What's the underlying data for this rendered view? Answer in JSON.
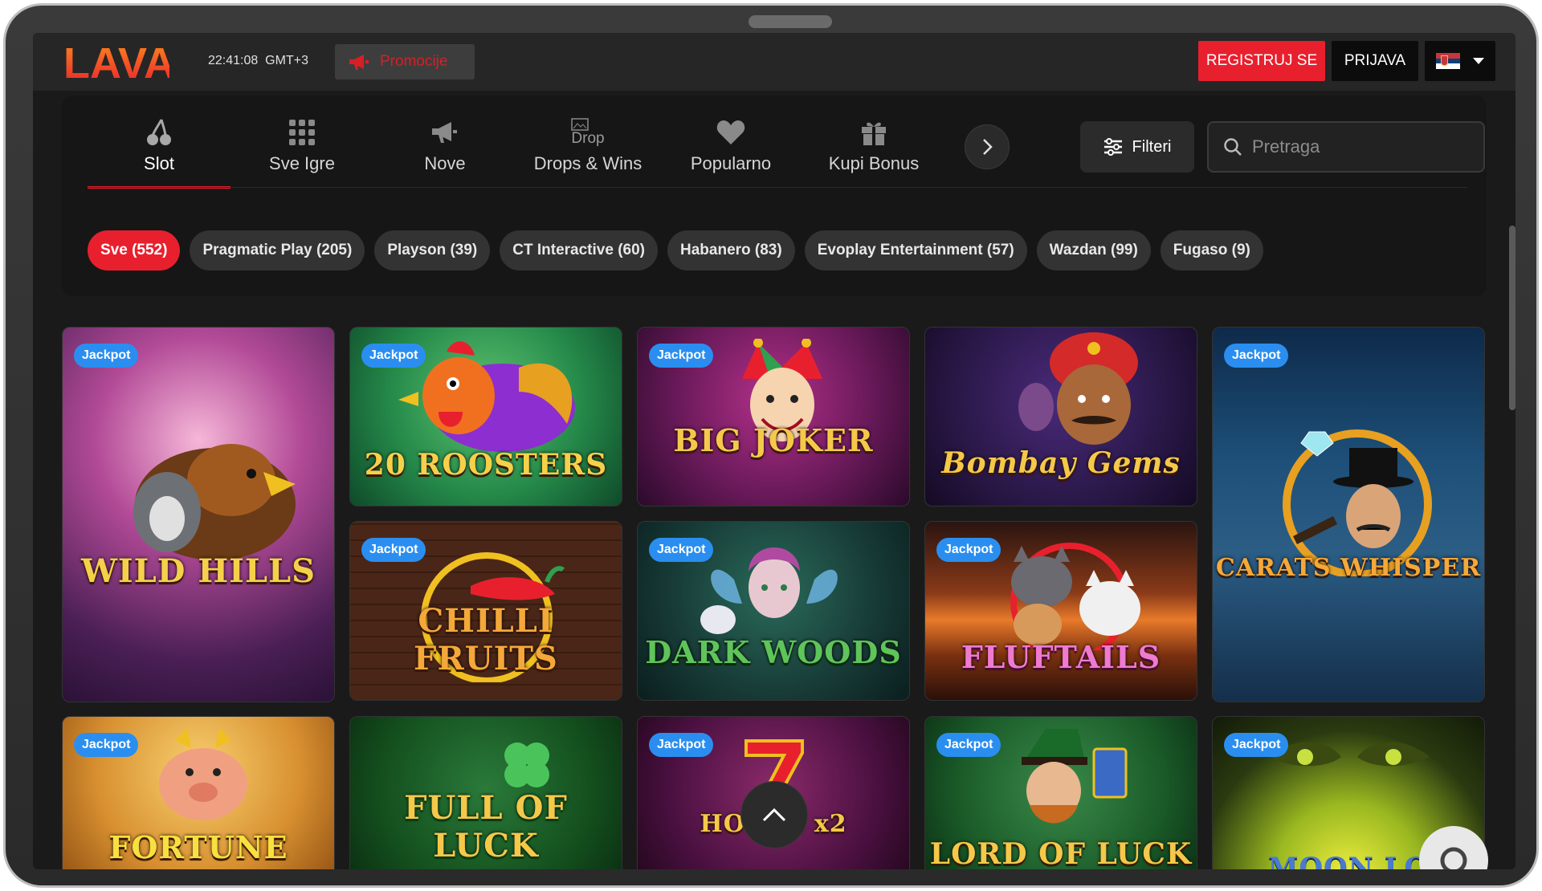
{
  "header": {
    "logo_text": "LAVA",
    "time": "22:41:08",
    "timezone": "GMT+3",
    "promo_label": "Promocije",
    "register_label": "REGISTRUJ SE",
    "login_label": "PRIJAVA",
    "language": "Serbian"
  },
  "nav": {
    "categories": [
      {
        "label": "Slot",
        "icon": "cherry-icon",
        "active": true
      },
      {
        "label": "Sve Igre",
        "icon": "grid-icon"
      },
      {
        "label": "Nove",
        "icon": "megaphone-icon"
      },
      {
        "label": "Drops & Wins",
        "icon": "drop-icon",
        "alt": "Drop"
      },
      {
        "label": "Popularno",
        "icon": "heart-icon"
      },
      {
        "label": "Kupi Bonus",
        "icon": "gift-icon"
      }
    ],
    "filter_label": "Filteri",
    "search_placeholder": "Pretraga"
  },
  "providers": [
    {
      "label": "Sve (552)",
      "active": true
    },
    {
      "label": "Pragmatic Play (205)"
    },
    {
      "label": "Playson (39)"
    },
    {
      "label": "CT Interactive (60)"
    },
    {
      "label": "Habanero (83)"
    },
    {
      "label": "Evoplay Entertainment (57)"
    },
    {
      "label": "Wazdan (99)"
    },
    {
      "label": "Fugaso (9)"
    }
  ],
  "games": [
    {
      "title": "WILD HILLS",
      "badge": "Jackpot"
    },
    {
      "title": "20 ROOSTERS",
      "badge": "Jackpot"
    },
    {
      "title": "BIG JOKER",
      "badge": "Jackpot"
    },
    {
      "title": "Bombay Gems",
      "badge": ""
    },
    {
      "title": "CARATS WHISPER",
      "badge": "Jackpot"
    },
    {
      "title": "CHILLI FRUITS",
      "badge": "Jackpot"
    },
    {
      "title": "DARK WOODS",
      "badge": "Jackpot"
    },
    {
      "title": "FLUFTAILS",
      "badge": "Jackpot"
    },
    {
      "title": "FORTUNE",
      "badge": "Jackpot"
    },
    {
      "title": "FULL OF LUCK",
      "badge": ""
    },
    {
      "title": "HOT 7s x2",
      "badge": "Jackpot"
    },
    {
      "title": "LORD OF LUCK",
      "badge": "Jackpot"
    },
    {
      "title": "MOON LO",
      "badge": "Jackpot"
    }
  ],
  "colors": {
    "accent": "#e8202e",
    "badge": "#2a8ef0",
    "background": "#1a1a1a"
  }
}
